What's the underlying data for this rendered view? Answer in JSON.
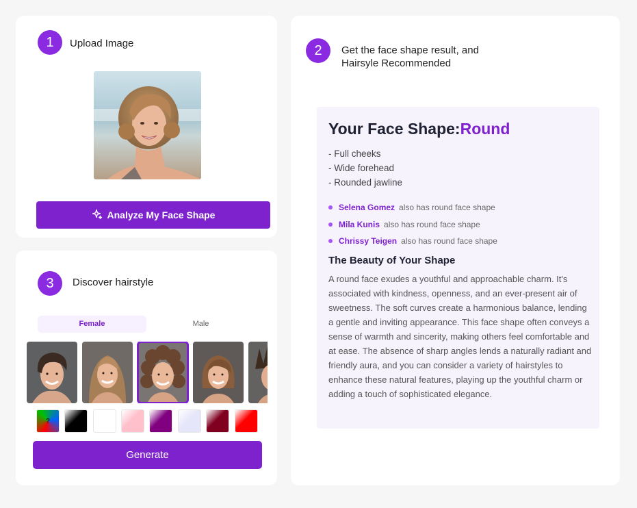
{
  "upload": {
    "step_number": "1",
    "title": "Upload Image",
    "analyze_label": "Analyze My Face Shape"
  },
  "result": {
    "step_number": "2",
    "title_line1": "Get the face shape result, and",
    "title_line2": "Hairsyle Recommended",
    "face_shape_label": "Your Face Shape:",
    "face_shape_value": "Round",
    "traits": [
      "- Full cheeks",
      "- Wide forehead",
      "- Rounded jawline"
    ],
    "celebrities": [
      {
        "name": "Selena Gomez",
        "suffix": "also has round face shape"
      },
      {
        "name": "Mila Kunis",
        "suffix": "also has round face shape"
      },
      {
        "name": "Chrissy Teigen",
        "suffix": "also has round face shape"
      }
    ],
    "beauty_heading": "The Beauty of Your Shape",
    "beauty_text": "A round face exudes a youthful and approachable charm. It's associated with kindness, openness, and an ever-present air of sweetness. The soft curves create a harmonious balance, lending a gentle and inviting appearance. This face shape often conveys a sense of warmth and sincerity, making others feel comfortable and at ease. The absence of sharp angles lends a naturally radiant and friendly aura, and you can consider a variety of hairstyles to enhance these natural features, playing up the youthful charm or adding a touch of sophisticated elegance."
  },
  "discover": {
    "step_number": "3",
    "title": "Discover hairstyle",
    "tabs": [
      {
        "label": "Female",
        "active": true
      },
      {
        "label": "Male",
        "active": false
      }
    ],
    "selected_style_index": 2,
    "swatch_random_label": "?",
    "swatch_colors": [
      "#000000",
      "#ffffff",
      "#ffc0cb",
      "#800080",
      "#e6e6fa",
      "#800020",
      "#ff0000"
    ],
    "generate_label": "Generate"
  },
  "colors": {
    "accent": "#7e22ce",
    "step_circle": "#8a2be2",
    "result_bg": "#f7f3fd"
  }
}
